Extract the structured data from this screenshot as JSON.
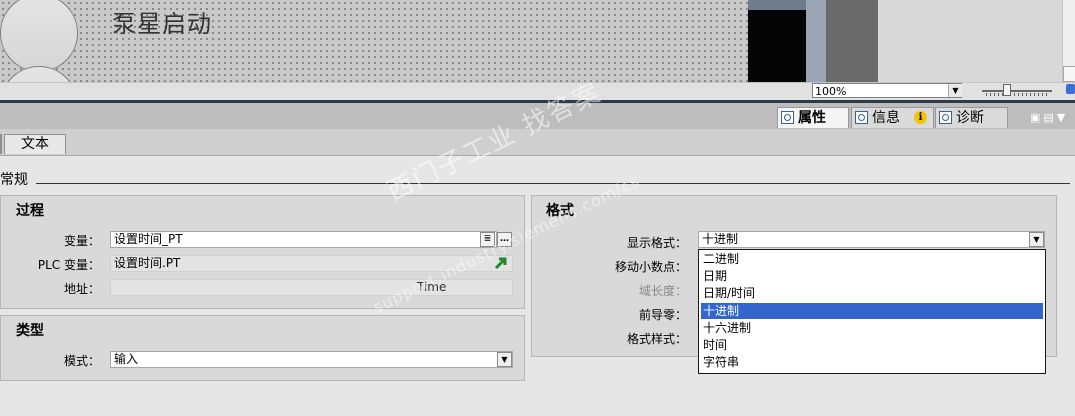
{
  "canvas": {
    "title": "泵星启动"
  },
  "zoom": {
    "value": "100%"
  },
  "inspector_tabs": [
    {
      "label": "属性",
      "icon": "properties-icon",
      "active": true
    },
    {
      "label": "信息",
      "icon": "info-icon",
      "active": false
    },
    {
      "label": "诊断",
      "icon": "diagnostics-icon",
      "active": false
    }
  ],
  "info_badge": "i",
  "sub_tab": "文本",
  "section": "常规",
  "process": {
    "title": "过程",
    "variable_label": "变量：",
    "variable_value": "设置时间_PT",
    "plc_label": "PLC 变量：",
    "plc_value": "设置时间.PT",
    "address_label": "地址：",
    "address_value": "Time"
  },
  "type": {
    "title": "类型",
    "mode_label": "模式：",
    "mode_value": "输入"
  },
  "format": {
    "title": "格式",
    "display_format_label": "显示格式：",
    "display_format_value": "十进制",
    "decimal_shift_label": "移动小数点：",
    "field_length_label": "域长度：",
    "leading_zeros_label": "前导零：",
    "format_style_label": "格式样式：",
    "options": [
      "二进制",
      "日期",
      "日期/时间",
      "十进制",
      "十六进制",
      "时间",
      "字符串"
    ],
    "selected_index": 3
  },
  "watermark": {
    "line1": "西门子工业  找答案",
    "line2": "support.industry.siemens.com/cs"
  }
}
